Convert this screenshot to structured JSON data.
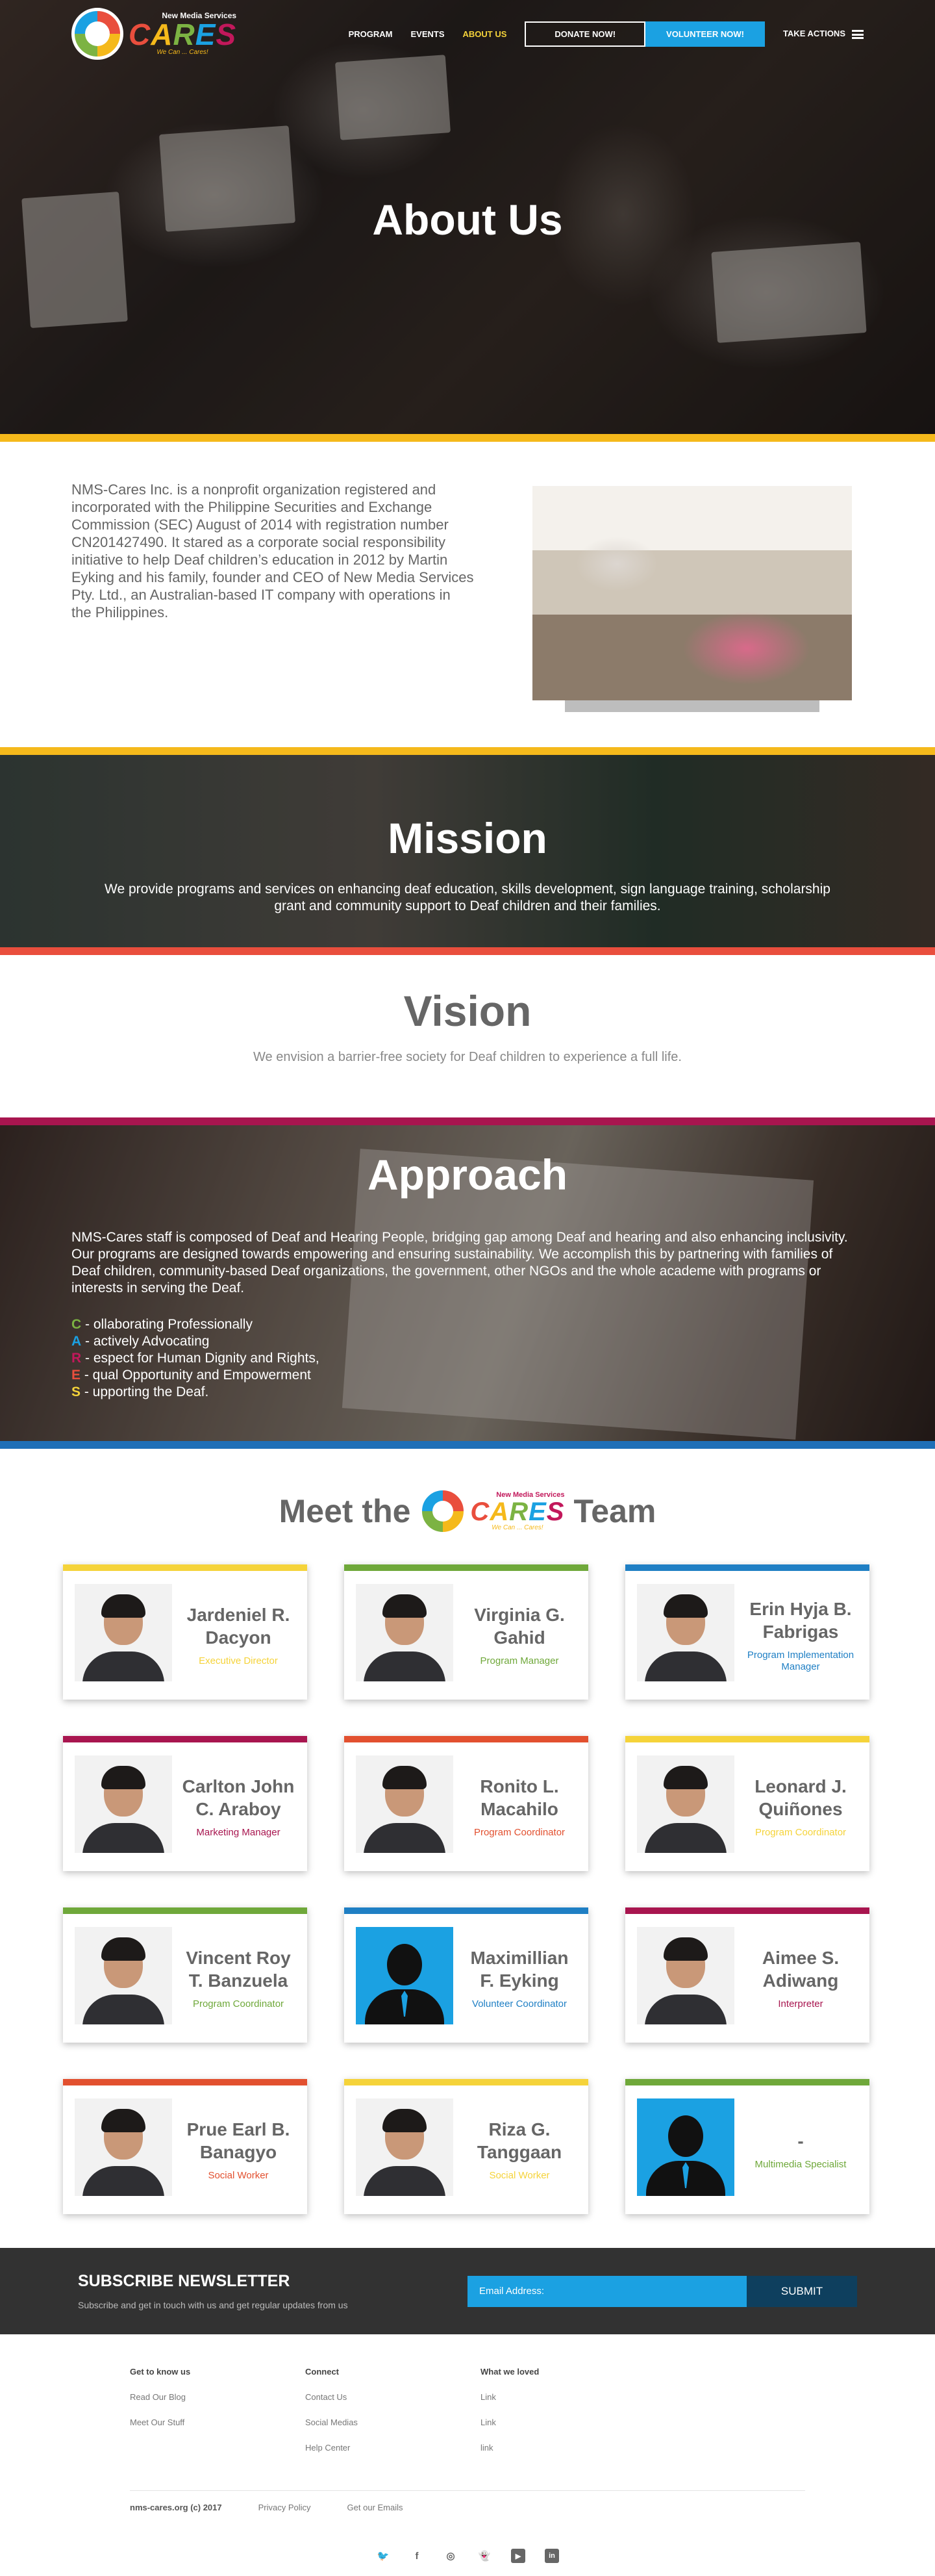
{
  "nav": {
    "logo": {
      "small": "New Media Services",
      "letters": [
        "C",
        "A",
        "R",
        "E",
        "S"
      ],
      "tag": "We Can ... Cares!"
    },
    "links": [
      "PROGRAM",
      "EVENTS",
      "ABOUT US"
    ],
    "donate": "DONATE NOW!",
    "volunteer": "VOLUNTEER NOW!",
    "take_actions": "TAKE ACTIONS"
  },
  "hero": {
    "title": "About Us"
  },
  "intro": {
    "text": "NMS-Cares Inc. is a nonprofit organization registered and incorporated with the Philippine Securities and Exchange Commission (SEC) August of 2014 with registration number CN201427490. It stared as a corporate social responsibility initiative to help Deaf children’s education in 2012 by Martin Eyking and his family, founder and CEO of New Media Services Pty. Ltd., an Australian-based IT company with operations in the Philippines."
  },
  "mission": {
    "title": "Mission",
    "text": "We provide programs and services on enhancing deaf education, skills development, sign language training, scholarship grant and community support to Deaf children and their families."
  },
  "vision": {
    "title": "Vision",
    "text": "We envision a barrier-free society for Deaf children to experience a full life."
  },
  "approach": {
    "title": "Approach",
    "text": "NMS-Cares staff is composed of Deaf and Hearing People, bridging gap among Deaf and hearing and also enhancing inclusivity. Our programs are designed towards empowering and ensuring sustainability. We accomplish this by partnering with families of Deaf children, community-based Deaf organizations, the government, other NGOs and the whole academe with programs or interests in serving the Deaf.",
    "cares": [
      {
        "letter": "C",
        "rest": " - ollaborating Professionally",
        "color": "#7cb343"
      },
      {
        "letter": "A",
        "rest": " - actively Advocating",
        "color": "#1ba1e2"
      },
      {
        "letter": "R",
        "rest": " - espect for Human Dignity and Rights,",
        "color": "#c2185b"
      },
      {
        "letter": "E",
        "rest": " - qual Opportunity and Empowerment",
        "color": "#e94e3d"
      },
      {
        "letter": "S",
        "rest": " - upporting the Deaf.",
        "color": "#f5d33a"
      }
    ]
  },
  "team": {
    "before": "Meet the",
    "after": "Team",
    "logo_small": "New Media Services",
    "logo_tag": "We Can ... Cares!",
    "members": [
      {
        "name": "Jardeniel R. Dacyon",
        "role": "Executive Director",
        "color": "#f5d33a",
        "photo": "photo"
      },
      {
        "name": "Virginia G. Gahid",
        "role": "Program Manager",
        "color": "#6fa83a",
        "photo": "photo"
      },
      {
        "name": "Erin Hyja B. Fabrigas",
        "role": "Program Implementation Manager",
        "color": "#1f7fc4",
        "photo": "photo"
      },
      {
        "name": "Carlton John C. Araboy",
        "role": "Marketing Manager",
        "color": "#a8154f",
        "photo": "photo"
      },
      {
        "name": "Ronito L. Macahilo",
        "role": "Program Coordinator",
        "color": "#e2502f",
        "photo": "photo"
      },
      {
        "name": "Leonard J. Quiñones",
        "role": "Program Coordinator",
        "color": "#f5d33a",
        "photo": "photo"
      },
      {
        "name": "Vincent Roy T. Banzuela",
        "role": "Program Coordinator",
        "color": "#6fa83a",
        "photo": "photo"
      },
      {
        "name": "Maximillian F. Eyking",
        "role": "Volunteer Coordinator",
        "color": "#1f7fc4",
        "photo": "silhouette"
      },
      {
        "name": "Aimee S. Adiwang",
        "role": "Interpreter",
        "color": "#a8154f",
        "photo": "photo"
      },
      {
        "name": "Prue Earl B. Banagyo",
        "role": "Social Worker",
        "color": "#e2502f",
        "photo": "photo"
      },
      {
        "name": "Riza G. Tanggaan",
        "role": "Social Worker",
        "color": "#f5d33a",
        "photo": "photo"
      },
      {
        "name": "-",
        "role": "Multimedia Specialist",
        "color": "#6fa83a",
        "photo": "silhouette"
      }
    ]
  },
  "newsletter": {
    "title": "SUBSCRIBE NEWSLETTER",
    "subtitle": "Subscribe and get in touch with us and get regular updates from us",
    "placeholder": "Email Address:",
    "button": "SUBMIT"
  },
  "footer": {
    "columns": [
      {
        "title": "Get to know us",
        "links": [
          "Read Our Blog",
          "Meet Our Stuff"
        ]
      },
      {
        "title": "Connect",
        "links": [
          "Contact Us",
          "Social Medias",
          "Help Center"
        ]
      },
      {
        "title": "What we loved",
        "links": [
          "Link",
          "Link",
          "link"
        ]
      }
    ],
    "copyright": "nms-cares.org (c) 2017",
    "privacy": "Privacy Policy",
    "emails": "Get our Emails",
    "socials": [
      {
        "name": "twitter-icon",
        "glyph": "🐦"
      },
      {
        "name": "facebook-icon",
        "glyph": "f"
      },
      {
        "name": "instagram-icon",
        "glyph": "◎"
      },
      {
        "name": "snapchat-icon",
        "glyph": "👻"
      },
      {
        "name": "youtube-icon",
        "glyph": "▶"
      },
      {
        "name": "linkedin-icon",
        "glyph": "in"
      }
    ]
  }
}
